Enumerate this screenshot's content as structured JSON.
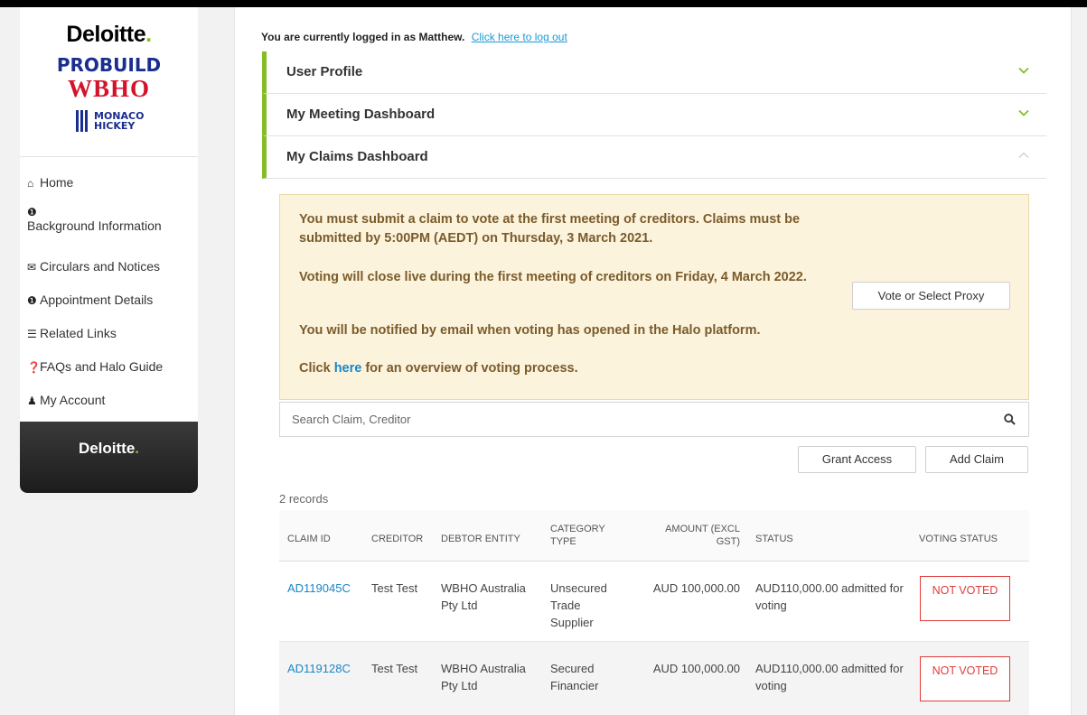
{
  "colors": {
    "accent_green": "#86bc25",
    "link_blue": "#1a86c7",
    "notice_bg": "#fcf3dc",
    "notice_text": "#7a5b2b",
    "badge_red": "#e23b3b"
  },
  "sidebar": {
    "logos": {
      "deloitte": "Deloitte",
      "deloitte_dot": ".",
      "probuild": "PROBUILD",
      "wbho": "WBHO",
      "monaco_line1": "MONACO",
      "monaco_line2": "HICKEY"
    },
    "items": [
      {
        "label": "Home",
        "icon": "home-icon"
      },
      {
        "label": "Background Information",
        "icon": "info-icon"
      },
      {
        "label": "Circulars and Notices",
        "icon": "envelope-icon"
      },
      {
        "label": "Appointment Details",
        "icon": "info-circle-icon"
      },
      {
        "label": "Related Links",
        "icon": "list-icon"
      },
      {
        "label": "FAQs and Halo Guide",
        "icon": "question-circle-icon"
      },
      {
        "label": "My Account",
        "icon": "user-icon"
      }
    ],
    "footer_logo": "Deloitte",
    "footer_dot": "."
  },
  "header": {
    "login_text": "You are currently logged in as Matthew.",
    "logout_link": "Click here to log out"
  },
  "accordions": [
    {
      "title": "User Profile",
      "state": "collapsed"
    },
    {
      "title": "My Meeting Dashboard",
      "state": "collapsed"
    },
    {
      "title": "My Claims Dashboard",
      "state": "expanded"
    }
  ],
  "notice": {
    "line1": "You must submit a claim to vote at the first meeting of creditors. Claims must be submitted by 5:00PM (AEDT) on Thursday, 3 March 2021.",
    "line2": "Voting will close live during the first meeting of creditors on Friday, 4 March 2022.",
    "line3": "You will be notified by email when voting has opened in the Halo platform.",
    "line4_pre": "Click ",
    "line4_link": "here",
    "line4_post": " for an overview of voting process.",
    "vote_button": "Vote or Select Proxy"
  },
  "search": {
    "placeholder": "Search Claim, Creditor"
  },
  "buttons": {
    "grant_access": "Grant Access",
    "add_claim": "Add Claim"
  },
  "records": "2 records",
  "table": {
    "headers": [
      "CLAIM ID",
      "CREDITOR",
      "DEBTOR ENTITY",
      "CATEGORY TYPE",
      "AMOUNT (EXCL GST)",
      "STATUS",
      "VOTING STATUS"
    ],
    "rows": [
      {
        "claim_id": "AD119045C",
        "creditor": "Test Test",
        "debtor": "WBHO Australia Pty Ltd",
        "category": "Unsecured Trade Supplier",
        "amount": "AUD 100,000.00",
        "status": "AUD110,000.00 admitted for voting",
        "voting_status": "NOT VOTED"
      },
      {
        "claim_id": "AD119128C",
        "creditor": "Test Test",
        "debtor": "WBHO Australia Pty Ltd",
        "category": "Secured Financier",
        "amount": "AUD 100,000.00",
        "status": "AUD110,000.00 admitted for voting",
        "voting_status": "NOT VOTED"
      }
    ]
  }
}
